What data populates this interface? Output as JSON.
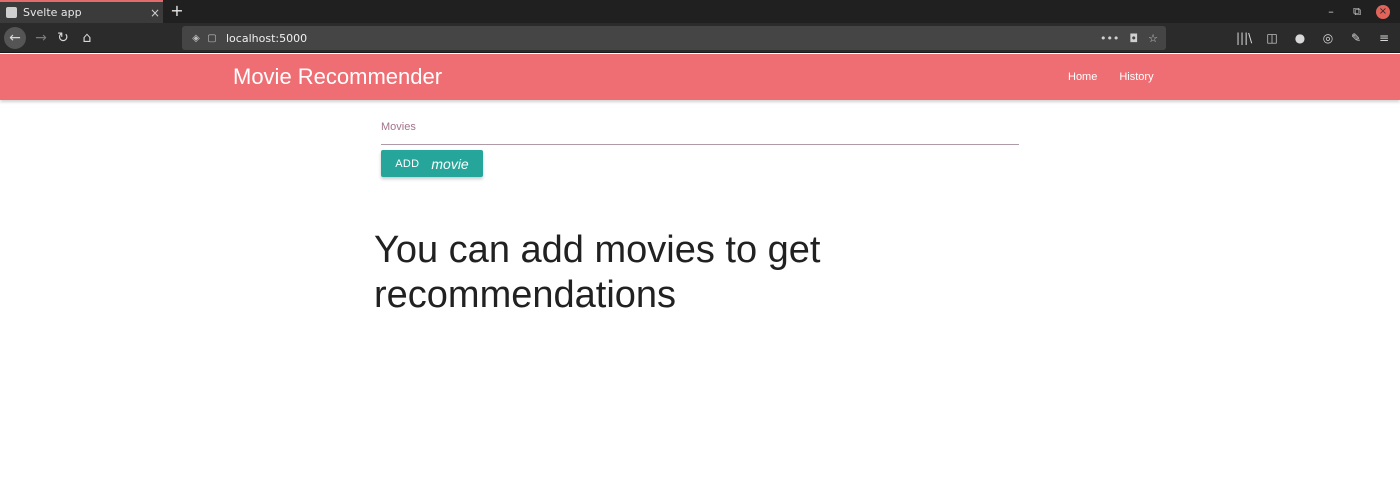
{
  "browser": {
    "tab_title": "Svelte app",
    "tab_close": "×",
    "new_tab": "+",
    "url": "localhost:5000",
    "url_icons": [
      "shield-icon",
      "page-info-icon"
    ],
    "url_actions": [
      "•••",
      "pocket-icon",
      "star-icon"
    ],
    "window_controls": [
      "minimize",
      "restore",
      "close"
    ]
  },
  "header": {
    "brand": "Movie Recommender",
    "nav": [
      {
        "label": "Home"
      },
      {
        "label": "History"
      }
    ]
  },
  "form": {
    "field_label": "Movies",
    "field_value": "",
    "button_text": "ADD",
    "button_icon_text": "movie"
  },
  "message": "You can add movies to get recommendations",
  "colors": {
    "header_bg": "#ee6e73",
    "button_bg": "#26a69a",
    "text": "#212121"
  }
}
